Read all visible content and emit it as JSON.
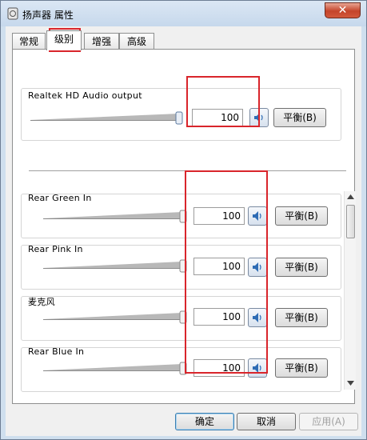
{
  "window": {
    "title": "扬声器 属性",
    "close_label": "✕"
  },
  "tabs": [
    {
      "label": "常规",
      "active": false
    },
    {
      "label": "级别",
      "active": true
    },
    {
      "label": "增强",
      "active": false
    },
    {
      "label": "高级",
      "active": false
    }
  ],
  "master": {
    "label": "Realtek HD Audio output",
    "value": "100",
    "level": 1.0,
    "balance_label": "平衡(B)"
  },
  "devices": [
    {
      "label": "Rear Green In",
      "value": "100",
      "level": 1.0,
      "balance_label": "平衡(B)"
    },
    {
      "label": "Rear Pink In",
      "value": "100",
      "level": 1.0,
      "balance_label": "平衡(B)"
    },
    {
      "label": "麦克风",
      "value": "100",
      "level": 1.0,
      "balance_label": "平衡(B)"
    },
    {
      "label": "Rear Blue In",
      "value": "100",
      "level": 1.0,
      "balance_label": "平衡(B)"
    }
  ],
  "footer": {
    "ok_label": "确定",
    "cancel_label": "取消",
    "apply_label": "应用(A)"
  },
  "colors": {
    "highlight": "#d9252b",
    "window_frame": "#cfdfee"
  },
  "icons": {
    "speaker": "speaker-icon",
    "scroll_up": "arrow-up-icon",
    "scroll_down": "arrow-down-icon"
  }
}
